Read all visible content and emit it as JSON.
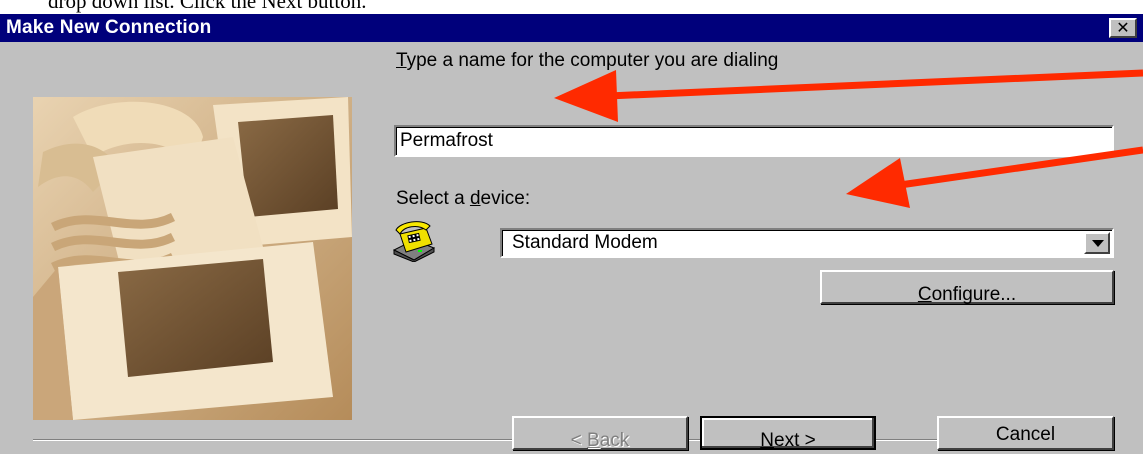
{
  "document": {
    "caption_fragment": "drop down list. Click the Next button."
  },
  "window": {
    "title": "Make New Connection",
    "close_symbol": "✕",
    "title_bar_color": "#00007b"
  },
  "form": {
    "name_label_first": "T",
    "name_label_rest": "ype a name for the computer you are dialing",
    "name_value": "Permafrost",
    "device_label_prefix": "Select a ",
    "device_label_key": "d",
    "device_label_rest": "evice:",
    "device_value": "Standard Modem",
    "device_icon": "phone-modem-icon",
    "configure_key": "C",
    "configure_rest": "onfigure..."
  },
  "buttons": {
    "back_prefix": "< ",
    "back_key": "B",
    "back_rest": "ack",
    "next_key": "N",
    "next_rest": "ext >",
    "cancel": "Cancel"
  },
  "annotations": {
    "arrow_color": "#ff2a00"
  }
}
